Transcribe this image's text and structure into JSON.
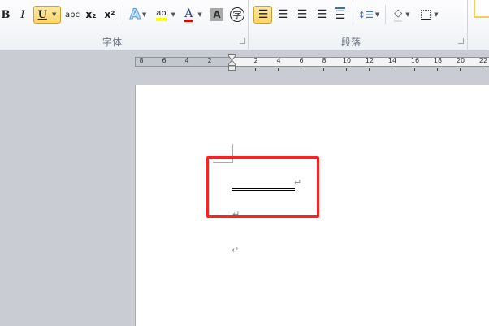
{
  "ribbon": {
    "font_group": {
      "label": "字体",
      "bold": "B",
      "italic": "I",
      "underline": "U",
      "strike": "abc",
      "subscript": "x₂",
      "superscript": "x²",
      "highlight": "ab",
      "font_color": "A",
      "shading": "A",
      "enclose": "字"
    },
    "paragraph_group": {
      "label": "段落"
    }
  },
  "ruler": {
    "left_labels": [
      "8",
      "6",
      "4",
      "2"
    ],
    "right_labels": [
      "2",
      "4",
      "6",
      "8",
      "10",
      "12",
      "14",
      "16",
      "18",
      "20",
      "22"
    ]
  },
  "document": {
    "paragraph_mark": "↵"
  },
  "colors": {
    "highlight": "#ffff00",
    "font_color": "#e00000",
    "selection_box": "#ff2020"
  }
}
